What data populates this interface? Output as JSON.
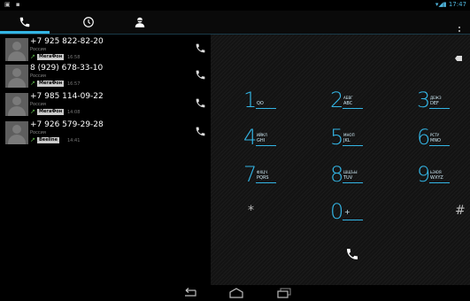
{
  "status_bar": {
    "left_icons": "▣ ▪",
    "time": "17:47"
  },
  "tabs": [
    {
      "name": "phone",
      "icon": "phone-icon",
      "active": true
    },
    {
      "name": "call-log",
      "icon": "clock-icon",
      "active": false
    },
    {
      "name": "contacts",
      "icon": "person-icon",
      "active": false
    }
  ],
  "call_log": [
    {
      "number": "+7 925 822-82-20",
      "region": "Россия",
      "carrier": "МегаФон",
      "time": "16:58",
      "direction": "outgoing"
    },
    {
      "number": "8 (929) 678-33-10",
      "region": "Россия",
      "carrier": "МегаФон",
      "time": "16:57",
      "direction": "outgoing"
    },
    {
      "number": "+7 985 114-09-22",
      "region": "Россия",
      "carrier": "МегаФон",
      "time": "14:08",
      "direction": "outgoing"
    },
    {
      "number": "+7 926 579-29-28",
      "region": "Россия",
      "carrier": "Beeline",
      "time": "14:41",
      "direction": "outgoing"
    }
  ],
  "keypad": {
    "keys": [
      {
        "digit": "1",
        "letters_ru": "",
        "letters_en": "QO"
      },
      {
        "digit": "2",
        "letters_ru": "АБВГ",
        "letters_en": "ABC"
      },
      {
        "digit": "3",
        "letters_ru": "ДЕЖЗ",
        "letters_en": "DEF"
      },
      {
        "digit": "4",
        "letters_ru": "ИЙКЛ",
        "letters_en": "GHI"
      },
      {
        "digit": "5",
        "letters_ru": "МНОП",
        "letters_en": "JKL"
      },
      {
        "digit": "6",
        "letters_ru": "РСТУ",
        "letters_en": "MNO"
      },
      {
        "digit": "7",
        "letters_ru": "ФХЦЧ",
        "letters_en": "PQRS"
      },
      {
        "digit": "8",
        "letters_ru": "ШЩЪЫ",
        "letters_en": "TUV"
      },
      {
        "digit": "9",
        "letters_ru": "ЬЭЮЯ",
        "letters_en": "WXYZ"
      }
    ],
    "star": "*",
    "zero": "0",
    "zero_sub": "+",
    "hash": "#"
  },
  "icons": {
    "backspace": "backspace-icon",
    "dial": "dial-phone-icon",
    "nav_back": "back-icon",
    "nav_home": "home-icon",
    "nav_recents": "recent-apps-icon"
  },
  "colors": {
    "accent": "#33b5e5",
    "outgoing_arrow": "#5db54a",
    "background": "#000000"
  }
}
